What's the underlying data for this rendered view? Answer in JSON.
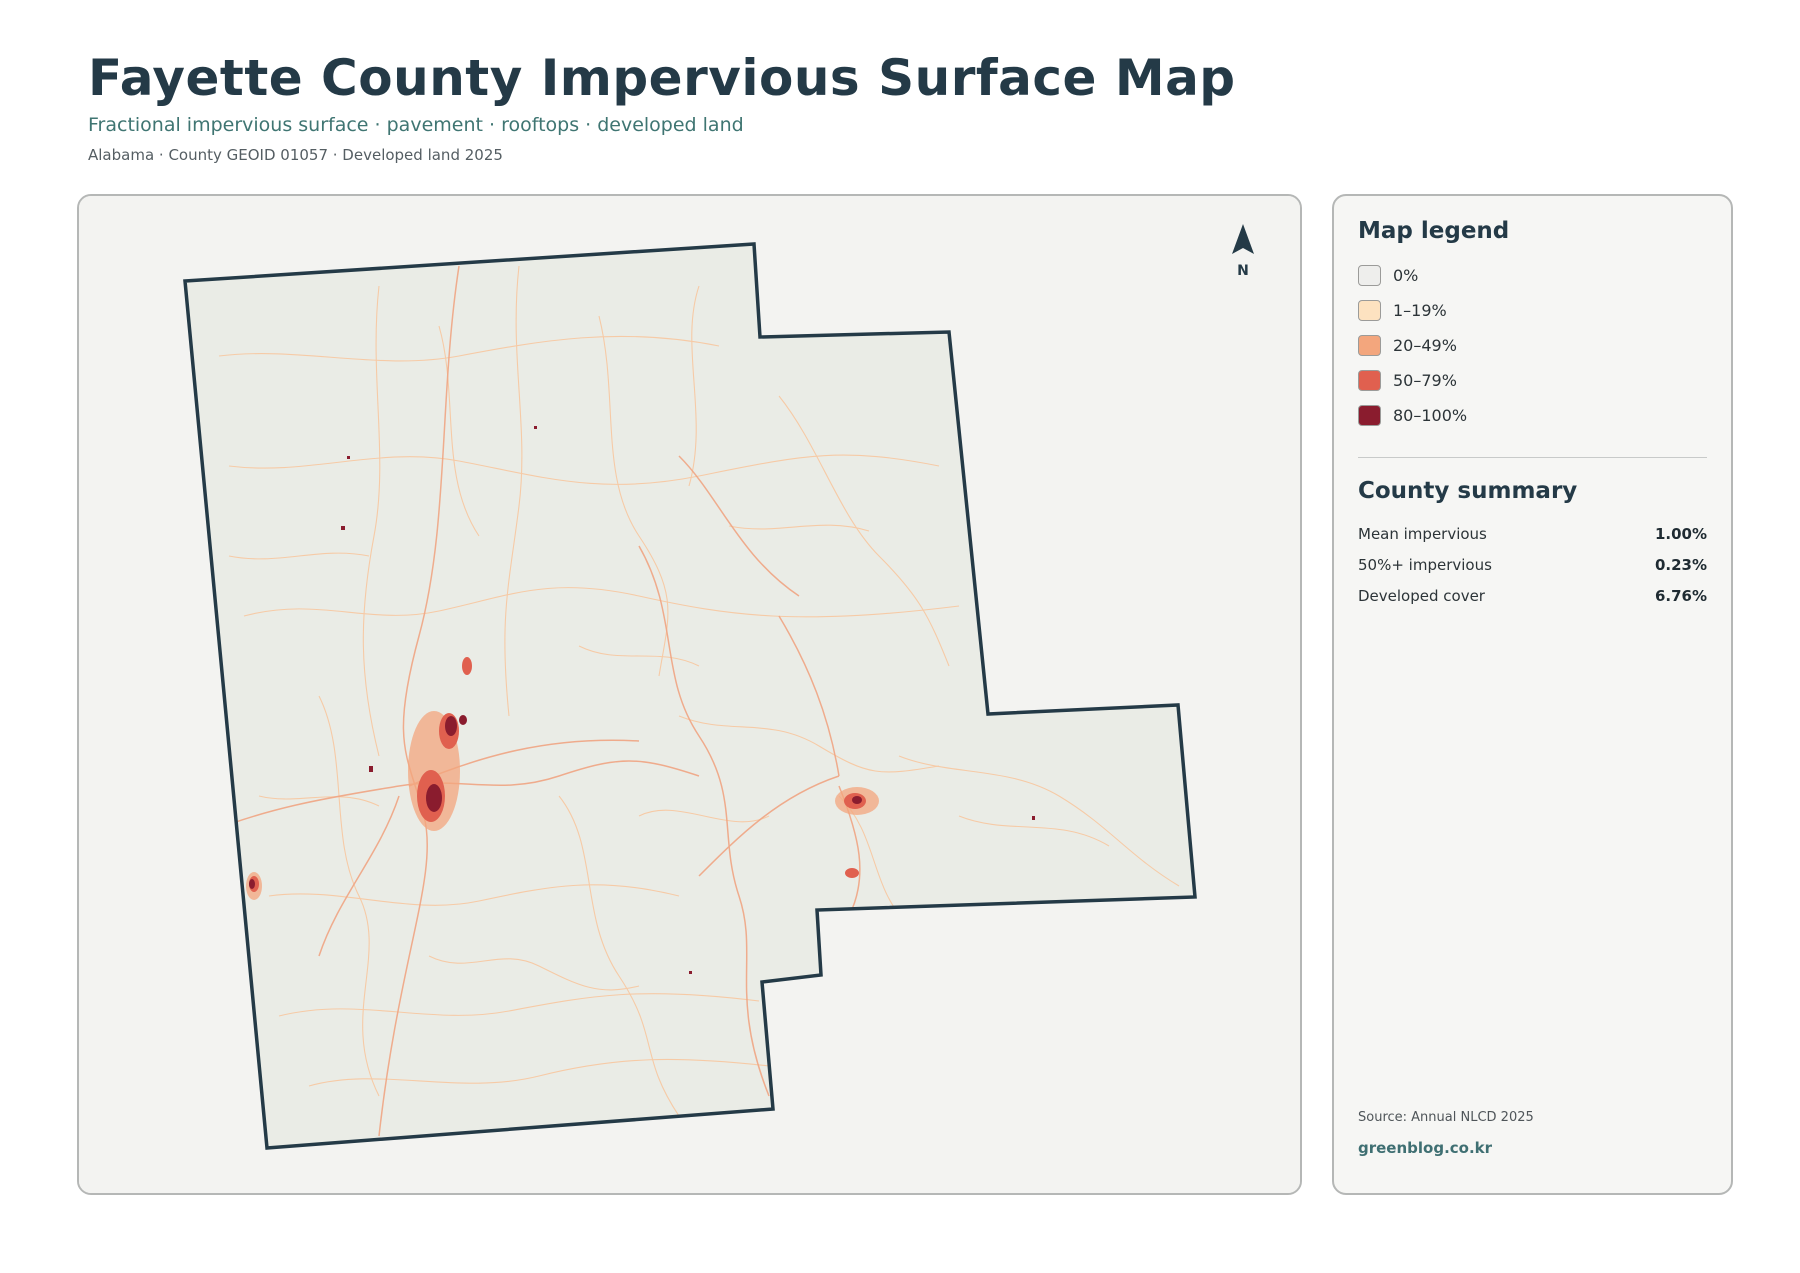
{
  "header": {
    "title": "Fayette County Impervious Surface Map",
    "subtitle": "Fractional impervious surface · pavement · rooftops · developed land",
    "meta": "Alabama · County GEOID 01057 · Developed land 2025"
  },
  "map": {
    "north_label": "N",
    "colors": {
      "background": "#f3f3f1",
      "county_fill": "#eaece6",
      "county_outline": "#243a47",
      "roads_light": "#f7c9a3",
      "roads": "#f0a583",
      "urban_mid": "#e0604f",
      "urban_high": "#8a1c2e"
    }
  },
  "legend": {
    "title": "Map legend",
    "items": [
      {
        "label": "0%",
        "color": "#eeeeec"
      },
      {
        "label": "1–19%",
        "color": "#fde2c0"
      },
      {
        "label": "20–49%",
        "color": "#f3a67d"
      },
      {
        "label": "50–79%",
        "color": "#e0604f"
      },
      {
        "label": "80–100%",
        "color": "#8a1c2e"
      }
    ]
  },
  "summary": {
    "title": "County summary",
    "stats": [
      {
        "label": "Mean impervious",
        "value": "1.00%"
      },
      {
        "label": "50%+ impervious",
        "value": "0.23%"
      },
      {
        "label": "Developed cover",
        "value": "6.76%"
      }
    ]
  },
  "footer": {
    "source": "Source: Annual NLCD 2025",
    "site": "greenblog.co.kr"
  }
}
